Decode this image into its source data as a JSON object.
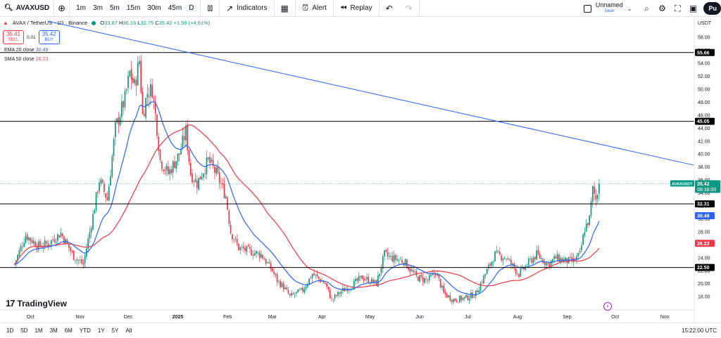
{
  "toolbar": {
    "symbol": "AVAXUSD",
    "timeframes": [
      "1m",
      "3m",
      "5m",
      "15m",
      "30m",
      "45m",
      "D"
    ],
    "active_timeframe": "D",
    "indicators_label": "Indicators",
    "alert_label": "Alert",
    "replay_label": "Replay",
    "layout_name": "Unnamed",
    "layout_status": "Save",
    "publish_label": "Pu"
  },
  "legend": {
    "title": "AVAX / TetherUS · 1D · Binance",
    "open_key": "O",
    "open": "33.87",
    "high_key": "H",
    "high": "36.16",
    "low_key": "L",
    "low": "32.75",
    "close_key": "C",
    "close": "35.42",
    "change": "+1.56 (+4.61%)",
    "sell_price": "35.41",
    "sell_label": "SELL",
    "spread": "0.01",
    "buy_price": "35.42",
    "buy_label": "BUY",
    "ema_label": "EMA 20 close",
    "ema_value": "30.49",
    "sma_label": "SMA 50 close",
    "sma_value": "26.23"
  },
  "bottom": {
    "ranges": [
      "1D",
      "5D",
      "1M",
      "3M",
      "6M",
      "YTD",
      "1Y",
      "5Y",
      "All"
    ],
    "time": "15:22:00 UTC",
    "logo_text": "TradingView"
  },
  "colors": {
    "up": "#089981",
    "down": "#f23645",
    "ema": "#2962ff",
    "sma": "#f23645",
    "trendline": "#2962ff",
    "hline": "#000000",
    "price_tag": "#089981"
  },
  "chart_data": {
    "type": "candlestick",
    "currency": "USDT",
    "y_ticks": [
      "58.00",
      "56.00",
      "54.00",
      "52.00",
      "50.00",
      "48.00",
      "46.00",
      "44.00",
      "42.00",
      "40.00",
      "38.00",
      "36.00",
      "34.00",
      "32.00",
      "30.00",
      "28.00",
      "26.00",
      "24.00",
      "22.00",
      "20.00",
      "18.00"
    ],
    "ylim": [
      16.5,
      59
    ],
    "x_ticks": [
      {
        "label": "Oct",
        "date": "2024-10-01"
      },
      {
        "label": "Nov",
        "date": "2024-11-01"
      },
      {
        "label": "Dec",
        "date": "2024-12-01"
      },
      {
        "label": "2025",
        "date": "2025-01-01"
      },
      {
        "label": "Feb",
        "date": "2025-02-01"
      },
      {
        "label": "Mar",
        "date": "2025-03-01"
      },
      {
        "label": "Apr",
        "date": "2025-04-01"
      },
      {
        "label": "May",
        "date": "2025-05-01"
      },
      {
        "label": "Jun",
        "date": "2025-06-01"
      },
      {
        "label": "Jul",
        "date": "2025-07-01"
      },
      {
        "label": "Aug",
        "date": "2025-08-01"
      },
      {
        "label": "Sep",
        "date": "2025-09-01"
      },
      {
        "label": "Oct",
        "date": "2025-10-01"
      },
      {
        "label": "Nov",
        "date": "2025-11-01"
      }
    ],
    "horizontal_levels": [
      "55.66",
      "45.05",
      "32.31",
      "22.50"
    ],
    "trendline": {
      "from": {
        "date": "2024-10-12",
        "price": 60.5
      },
      "to": {
        "date": "2025-11-19",
        "price": 38.3
      }
    },
    "last_price": {
      "label": "AVAXUSDT",
      "price": "35.42",
      "countdown": "08:38:00"
    },
    "ema_tag": "30.49",
    "sma_tag": "26.23",
    "anchors": [
      [
        "2024-09-21",
        23.0
      ],
      [
        "2024-09-28",
        27.5
      ],
      [
        "2024-10-06",
        25.8
      ],
      [
        "2024-10-12",
        26.2
      ],
      [
        "2024-10-20",
        27.8
      ],
      [
        "2024-10-28",
        24.2
      ],
      [
        "2024-11-03",
        23.0
      ],
      [
        "2024-11-09",
        30.5
      ],
      [
        "2024-11-13",
        36.0
      ],
      [
        "2024-11-18",
        33.0
      ],
      [
        "2024-11-23",
        44.0
      ],
      [
        "2024-11-29",
        48.5
      ],
      [
        "2024-12-02",
        52.5
      ],
      [
        "2024-12-05",
        50.5
      ],
      [
        "2024-12-08",
        54.5
      ],
      [
        "2024-12-10",
        46.0
      ],
      [
        "2024-12-13",
        49.5
      ],
      [
        "2024-12-16",
        50.0
      ],
      [
        "2024-12-19",
        44.0
      ],
      [
        "2024-12-21",
        39.0
      ],
      [
        "2024-12-26",
        37.0
      ],
      [
        "2025-01-02",
        40.0
      ],
      [
        "2025-01-06",
        43.5
      ],
      [
        "2025-01-09",
        37.0
      ],
      [
        "2025-01-13",
        35.5
      ],
      [
        "2025-01-20",
        39.0
      ],
      [
        "2025-01-25",
        37.0
      ],
      [
        "2025-01-31",
        33.5
      ],
      [
        "2025-02-03",
        28.0
      ],
      [
        "2025-02-08",
        25.5
      ],
      [
        "2025-02-15",
        25.0
      ],
      [
        "2025-02-22",
        24.5
      ],
      [
        "2025-03-01",
        22.0
      ],
      [
        "2025-03-04",
        20.5
      ],
      [
        "2025-03-08",
        19.5
      ],
      [
        "2025-03-12",
        18.0
      ],
      [
        "2025-03-20",
        19.0
      ],
      [
        "2025-03-26",
        21.5
      ],
      [
        "2025-04-03",
        20.0
      ],
      [
        "2025-04-07",
        17.5
      ],
      [
        "2025-04-13",
        18.8
      ],
      [
        "2025-04-20",
        19.8
      ],
      [
        "2025-04-26",
        21.0
      ],
      [
        "2025-05-05",
        20.0
      ],
      [
        "2025-05-10",
        24.5
      ],
      [
        "2025-05-14",
        24.0
      ],
      [
        "2025-05-22",
        23.5
      ],
      [
        "2025-05-30",
        21.0
      ],
      [
        "2025-06-06",
        20.5
      ],
      [
        "2025-06-11",
        21.8
      ],
      [
        "2025-06-16",
        18.5
      ],
      [
        "2025-06-22",
        17.5
      ],
      [
        "2025-06-30",
        17.8
      ],
      [
        "2025-07-06",
        18.5
      ],
      [
        "2025-07-12",
        21.5
      ],
      [
        "2025-07-18",
        24.5
      ],
      [
        "2025-07-25",
        24.0
      ],
      [
        "2025-08-02",
        21.5
      ],
      [
        "2025-08-09",
        23.5
      ],
      [
        "2025-08-13",
        24.5
      ],
      [
        "2025-08-20",
        23.0
      ],
      [
        "2025-08-25",
        24.0
      ],
      [
        "2025-08-31",
        23.5
      ],
      [
        "2025-09-05",
        23.5
      ],
      [
        "2025-09-09",
        24.5
      ],
      [
        "2025-09-12",
        28.5
      ],
      [
        "2025-09-15",
        30.0
      ],
      [
        "2025-09-17",
        34.5
      ],
      [
        "2025-09-19",
        33.0
      ],
      [
        "2025-09-21",
        35.4
      ]
    ]
  }
}
